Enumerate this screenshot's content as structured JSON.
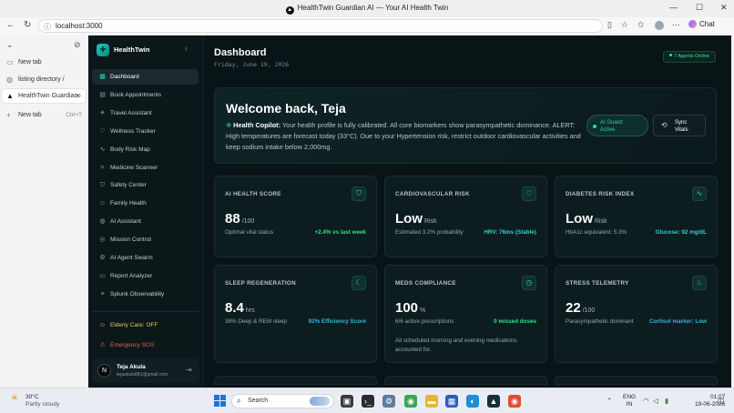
{
  "window": {
    "title": "HealthTwin Guardian AI — Your AI Health Twin",
    "minimize": "—",
    "maximize": "☐",
    "close": "✕"
  },
  "browser": {
    "url": "localhost:3000",
    "chat_label": "Chat",
    "tabs": [
      {
        "label": "New tab",
        "icon": "page-icon"
      },
      {
        "label": "listing directory /",
        "icon": "globe-icon"
      },
      {
        "label": "HealthTwin Guardian ·",
        "icon": "healthtwin-icon",
        "active": true
      },
      {
        "label": "New tab",
        "shortcut": "Ctrl+T",
        "icon": "plus-icon"
      }
    ]
  },
  "app": {
    "brand": "HealthTwin",
    "sidebar": {
      "items": [
        {
          "label": "Dashboard",
          "icon": "grid-icon",
          "glyph": "▦",
          "active": true
        },
        {
          "label": "Book Appointments",
          "icon": "calendar-icon",
          "glyph": "▤"
        },
        {
          "label": "Travel Assistant",
          "icon": "plane-icon",
          "glyph": "✈"
        },
        {
          "label": "Wellness Tracker",
          "icon": "heart-icon",
          "glyph": "♡"
        },
        {
          "label": "Body Risk Map",
          "icon": "pulse-icon",
          "glyph": "∿"
        },
        {
          "label": "Medicine Scanner",
          "icon": "scan-icon",
          "glyph": "⌗"
        },
        {
          "label": "Safety Center",
          "icon": "shield-icon",
          "glyph": "⛉"
        },
        {
          "label": "Family Health",
          "icon": "users-icon",
          "glyph": "☺"
        },
        {
          "label": "AI Assistant",
          "icon": "globe-icon",
          "glyph": "◍"
        },
        {
          "label": "Mission Control",
          "icon": "target-icon",
          "glyph": "◎"
        },
        {
          "label": "AI Agent Swarm",
          "icon": "robot-icon",
          "glyph": "⚙"
        },
        {
          "label": "Report Analyzer",
          "icon": "document-icon",
          "glyph": "▭"
        },
        {
          "label": "Splunk Observability",
          "icon": "database-icon",
          "glyph": "≡"
        }
      ],
      "elderly_care": "Elderly Care: OFF",
      "emergency_sos": "Emergency SOS",
      "user": {
        "initial": "N",
        "name": "Teja Akula",
        "email": "tejaakula881@gmail.com"
      }
    },
    "header": {
      "title": "Dashboard",
      "date": "Friday, June 19, 2026",
      "agents_online": "7 Agents Online"
    },
    "welcome": {
      "title": "Welcome back, Teja",
      "copilot_label": "Health Copilot:",
      "copilot_text": "Your health profile is fully calibrated. All core biomarkers show parasympathetic dominance. ALERT: High temperatures are forecast today (33°C). Due to your Hypertension risk, restrict outdoor cardiovascular activities and keep sodium intake below 2,000mg.",
      "guard_line1": "AI Guard:",
      "guard_line2": "Active",
      "sync_line1": "Sync",
      "sync_line2": "Vitals"
    },
    "cards": [
      {
        "label": "AI HEALTH SCORE",
        "icon": "shield-check-icon",
        "glyph": "⛉",
        "value": "88",
        "unit": "/100",
        "sub": "Optimal vital status",
        "meta": "+2.4% vs last week",
        "meta_color": "green"
      },
      {
        "label": "CARDIOVASCULAR RISK",
        "icon": "heart-icon",
        "glyph": "♡",
        "value": "Low",
        "unit": "Risk",
        "sub": "Estimated 3.2% probability",
        "meta": "HRV: 76ms (Stable)",
        "meta_color": "teal"
      },
      {
        "label": "DIABETES RISK INDEX",
        "icon": "activity-icon",
        "glyph": "∿",
        "value": "Low",
        "unit": "Risk",
        "sub": "HbA1c equivalent: 5.3%",
        "meta": "Glucose: 92 mg/dL",
        "meta_color": "teal"
      },
      {
        "label": "SLEEP REGENERATION",
        "icon": "moon-icon",
        "glyph": "☾",
        "value": "8.4",
        "unit": "hrs",
        "sub": "38% Deep & REM sleep",
        "meta": "92% Efficiency Score",
        "meta_color": "cyan"
      },
      {
        "label": "MEDS COMPLIANCE",
        "icon": "clock-icon",
        "glyph": "◷",
        "value": "100",
        "unit": "%",
        "sub": "6/6 active prescriptions",
        "meta": "0 missed doses",
        "meta_color": "green",
        "note": "All scheduled morning and evening medications accounted for."
      },
      {
        "label": "STRESS TELEMETRY",
        "icon": "flame-icon",
        "glyph": "♨",
        "value": "22",
        "unit": "/100",
        "sub": "Parasympathetic dominant",
        "meta": "Cortisol marker: Low",
        "meta_color": "cyan"
      }
    ]
  },
  "taskbar": {
    "weather_temp": "30°C",
    "weather_desc": "Partly cloudy",
    "search_placeholder": "Search",
    "lang_line1": "ENG",
    "lang_line2": "IN",
    "time": "01:07",
    "date": "19-06-2026"
  }
}
